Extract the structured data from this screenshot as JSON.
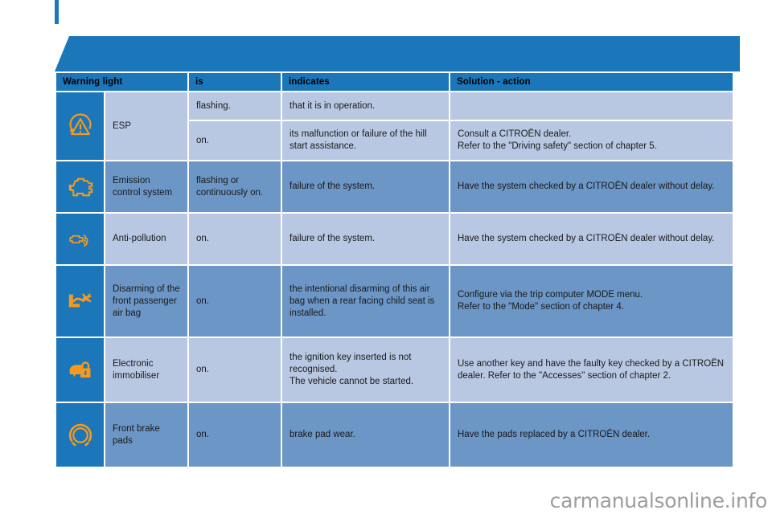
{
  "colors": {
    "accent_blue": "#1b76ba",
    "row_light": "#b8c8e2",
    "row_dark": "#6b96c6",
    "icon_orange": "#f59a1e",
    "watermark_grey": "#9d9d9d"
  },
  "banner": {
    "shape": "parallelogram-banner"
  },
  "table": {
    "headers": [
      "Warning light",
      "is",
      "indicates",
      "Solution - action"
    ],
    "rows": [
      {
        "icon": "esp-warning-icon",
        "name": "ESP",
        "band": "light",
        "subrows": [
          {
            "is": "flashing.",
            "indicates": "that it is in operation.",
            "solution": ""
          },
          {
            "is": "on.",
            "indicates": "its malfunction or failure of the hill start assistance.",
            "solution": "Consult a CITROËN dealer.\nRefer to the \"Driving safety\" section of chapter 5."
          }
        ]
      },
      {
        "icon": "engine-check-icon",
        "name": "Emission control system",
        "band": "dark",
        "subrows": [
          {
            "is": "flashing or continuously on.",
            "indicates": "failure of the system.",
            "solution": "Have the system checked by a CITROËN dealer without delay."
          }
        ]
      },
      {
        "icon": "anti-pollution-exhaust-icon",
        "name": "Anti-pollution",
        "band": "light",
        "subrows": [
          {
            "is": "on.",
            "indicates": "failure of the system.",
            "solution": "Have the system checked by a CITROËN dealer without delay."
          }
        ]
      },
      {
        "icon": "passenger-airbag-disarmed-icon",
        "name": "Disarming of the front passenger air bag",
        "band": "dark",
        "subrows": [
          {
            "is": "on.",
            "indicates": "the intentional disarming of this air bag when a rear facing child seat is installed.",
            "solution": "Configure via the trip computer MODE menu.\nRefer to the \"Mode\" section of chapter 4."
          }
        ]
      },
      {
        "icon": "electronic-immobiliser-icon",
        "name": "Electronic immobiliser",
        "band": "light",
        "subrows": [
          {
            "is": "on.",
            "indicates": "the ignition key inserted is not recognised.\nThe vehicle cannot be started.",
            "solution": "Use another key and have the faulty key checked by a CITROËN dealer. Refer to the \"Accesses\" section of chapter 2."
          }
        ]
      },
      {
        "icon": "front-brake-pads-icon",
        "name": "Front brake pads",
        "band": "dark",
        "subrows": [
          {
            "is": "on.",
            "indicates": "brake pad wear.",
            "solution": "Have the pads replaced by a CITROËN dealer."
          }
        ]
      }
    ]
  },
  "watermark": {
    "text": "carmanualsonline.info"
  }
}
